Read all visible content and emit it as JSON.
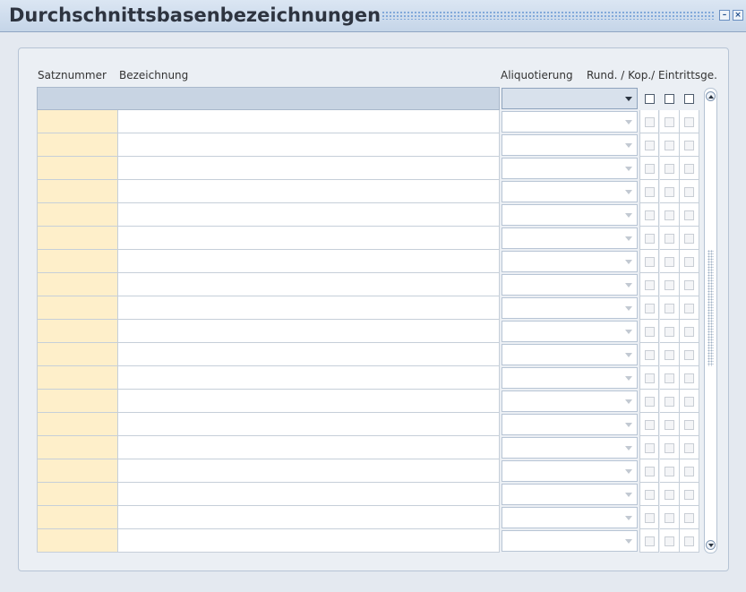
{
  "window": {
    "title": "Durchschnittsbasenbezeichnungen",
    "minimize_icon": "minimize-icon",
    "close_icon": "close-icon"
  },
  "table": {
    "headers": {
      "satznummer": "Satznummer",
      "bezeichnung": "Bezeichnung",
      "aliquotierung": "Aliquotierung",
      "flags": "Rund. / Kop./ Eintrittsge."
    },
    "row_count": 19,
    "rows": []
  },
  "colors": {
    "number_cell": "#feefca",
    "header_row": "#c8d4e3",
    "titlebar": "#c5d5e8"
  }
}
